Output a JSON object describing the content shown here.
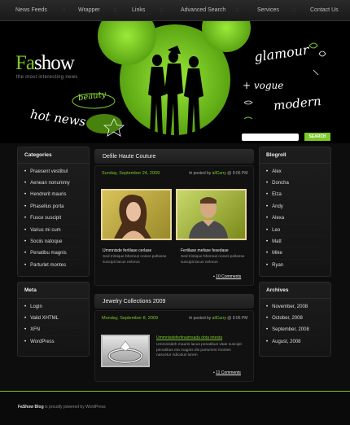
{
  "nav": {
    "items": [
      "News Feeds",
      "Wrapper",
      "Links",
      "Advanced Search",
      "Services",
      "Contact Us"
    ]
  },
  "header": {
    "logo_a": "Fa",
    "logo_b": "show",
    "tagline": "the most interesting news",
    "deco": [
      "glamour",
      "+ vogue",
      "modern",
      "beauty",
      "hot news"
    ],
    "search_button": "SEARCH",
    "search_value": ""
  },
  "categories": {
    "title": "Categories",
    "items": [
      "Praesent vestibul",
      "Aenean nonummy",
      "Hendrerit mauris",
      "Phasellus porta",
      "Fusce suscipit",
      "Varius mi cum",
      "Sociis natoque",
      "Penatibu magnis",
      "Parturlet montes"
    ]
  },
  "meta": {
    "title": "Meta",
    "items": [
      "Login",
      "Valid XHTML",
      "XFN",
      "WordPress"
    ]
  },
  "blogroll": {
    "title": "Blogroll",
    "items": [
      "Alex",
      "Doncha",
      "Elza",
      "Andy",
      "Alexa",
      "Leo",
      "Matt",
      "Mike",
      "Ryan"
    ]
  },
  "archives": {
    "title": "Archives",
    "items": [
      "November, 2008",
      "October, 2008",
      "September, 2008",
      "August, 2008"
    ]
  },
  "posts": [
    {
      "title": "Defile Haute Couture",
      "date": "Sunday, September 24, 2009",
      "meta_prefix": "posted by",
      "author": "allCarry",
      "time": "@ 9:06 PM",
      "captions": [
        {
          "title": "Ummnisde fertilase cerlase",
          "text": "Sed tristique bhemus nones pellasse suscipit lacus nelorus"
        },
        {
          "title": "Fertilase mefase fesedase",
          "text": "Sed tristique bhemus nones pellasse suscipit lacus nelorus"
        }
      ],
      "comments": "10 Comments"
    },
    {
      "title": "Jewelry Collections 2009",
      "date": "Monday, September 8, 2009",
      "meta_prefix": "posted by",
      "author": "allCarry",
      "time": "@ 9:06 PM",
      "link": "Ummnisdefertinaimsada dota intesta",
      "text": "Ummnisdeh mauris lacus penatibus vitae suscipit penatibus eta magnis dis parturient montes nascetur ridiculus lorem",
      "comments": "11 Comments"
    }
  ],
  "footer": {
    "brand": "FaShow Blog",
    "rest": " is proudly powered by WordPress"
  },
  "colors": {
    "accent": "#7dc82a",
    "background": "#0d0d0d"
  }
}
